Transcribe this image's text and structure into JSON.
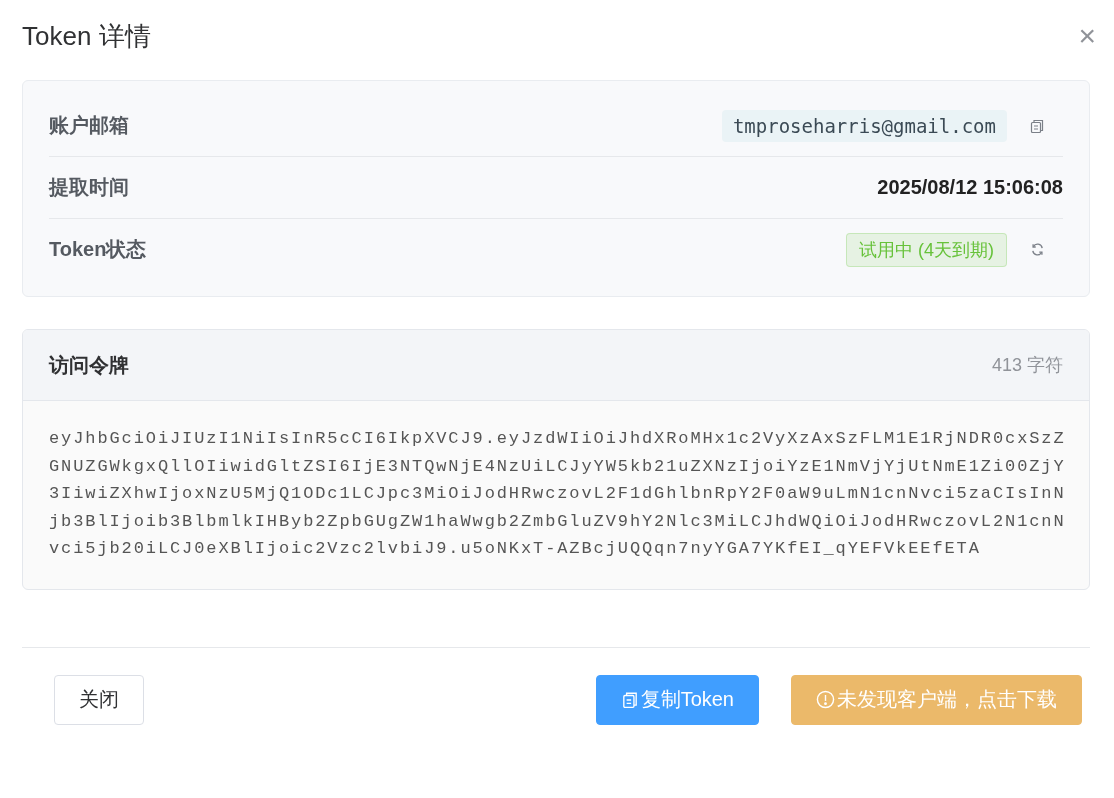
{
  "dialog": {
    "title": "Token 详情",
    "close": "×"
  },
  "info": [
    {
      "kind": "email",
      "label": "账户邮箱",
      "value": "tmproseharris@gmail.com"
    },
    {
      "kind": "time",
      "label": "提取时间",
      "value": "2025/08/12 15:06:08"
    },
    {
      "kind": "status",
      "label": "Token状态",
      "value": "试用中 (4天到期)",
      "color": "#67c23a"
    }
  ],
  "token": {
    "title": "访问令牌",
    "count": "413 字符",
    "value": "eyJhbGciOiJIUzI1NiIsInR5cCI6IkpXVCJ9.eyJzdWIiOiJhdXRoMHx1c2VyXzAxSzFLM1E1RjNDR0cxSzZGNUZGWkgxQllOIiwidGltZSI6IjE3NTQwNjE4NzUiLCJyYW5kb21uZXNzIjoiYzE1NmVjYjUtNmE1Zi00ZjY3IiwiZXhwIjoxNzU5MjQ1ODc1LCJpc3MiOiJodHRwczovL2F1dGhlbnRpY2F0aW9uLmN1cnNvci5zaCIsInNjb3BlIjoib3BlbmlkIHByb2ZpbGUgZW1haWwgb2ZmbGluZV9hY2Nlc3MiLCJhdWQiOiJodHRwczovL2N1cnNvci5jb20iLCJ0eXBlIjoic2Vzc2lvbiJ9.u5oNKxT-AZBcjUQQqn7nyYGA7YKfEI_qYEFVkEEfETA"
  },
  "buttons": [
    {
      "kind": "default",
      "label": "关闭"
    },
    {
      "kind": "primary",
      "label": "复制Token"
    },
    {
      "kind": "warning",
      "label": "未发现客户端，点击下载"
    }
  ]
}
